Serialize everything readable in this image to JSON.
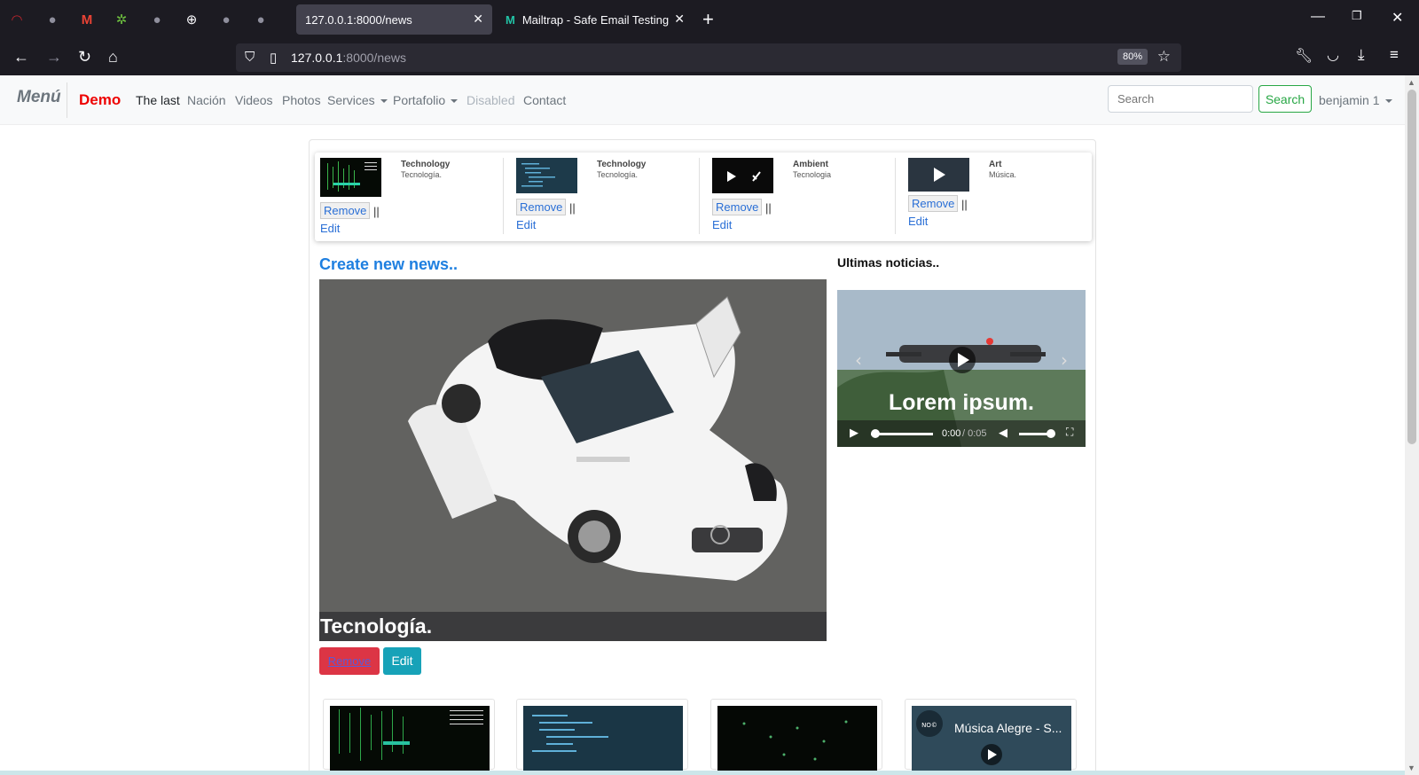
{
  "browser": {
    "tabs": [
      {
        "title": "127.0.0.1:8000/news"
      },
      {
        "title": "Mailtrap - Safe Email Testing"
      }
    ],
    "url_host": "127.0.0.1",
    "url_path": ":8000/news",
    "zoom": "80%"
  },
  "site": {
    "brand": "Menú",
    "demo": "Demo",
    "nav": [
      {
        "label": "The last"
      },
      {
        "label": "Nación"
      },
      {
        "label": "Videos"
      },
      {
        "label": "Photos"
      },
      {
        "label": "Services"
      },
      {
        "label": "Portafolio"
      },
      {
        "label": "Disabled"
      },
      {
        "label": "Contact"
      }
    ],
    "search_placeholder": "Search",
    "search_button": "Search",
    "user": "benjamin 1"
  },
  "strip": [
    {
      "title": "Technology",
      "subtitle": "Tecnología.",
      "remove": "Remove",
      "sep": "||",
      "edit": "Edit"
    },
    {
      "title": "Technology",
      "subtitle": "Tecnología.",
      "remove": "Remove",
      "sep": "||",
      "edit": "Edit"
    },
    {
      "title": "Ambient",
      "subtitle": "Tecnologia",
      "remove": "Remove",
      "sep": "||",
      "edit": "Edit"
    },
    {
      "title": "Art",
      "subtitle": "Música.",
      "remove": "Remove",
      "sep": "||",
      "edit": "Edit"
    }
  ],
  "main": {
    "create_link": "Create new news..",
    "caption": "Tecnología.",
    "remove": "Remove",
    "edit": "Edit"
  },
  "sidebar": {
    "title": "Ultimas noticias..",
    "video_caption": "Lorem ipsum.",
    "time_current": "0:00",
    "time_total": "/ 0:05"
  },
  "bottom": {
    "video_title": "Música Alegre - S..."
  }
}
